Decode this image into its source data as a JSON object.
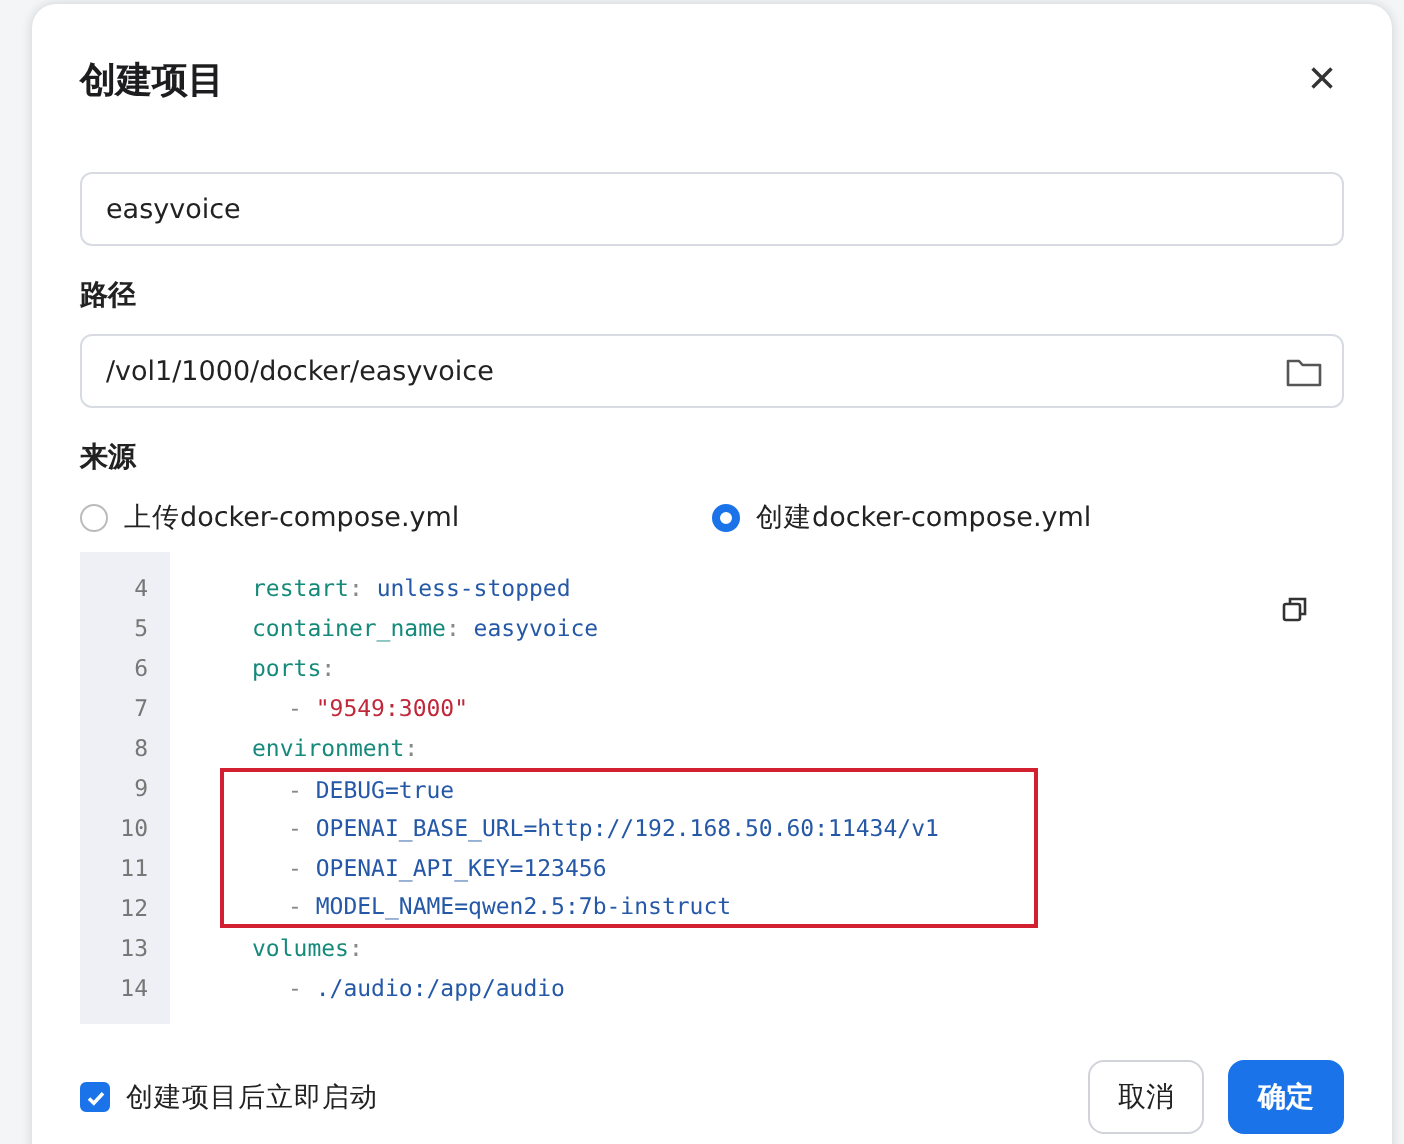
{
  "dialog": {
    "title": "创建项目",
    "close": "×"
  },
  "name_field": {
    "value": "easyvoice"
  },
  "path_field": {
    "label": "路径",
    "value": "/vol1/1000/docker/easyvoice"
  },
  "source": {
    "label": "来源",
    "options": [
      {
        "label": "上传docker-compose.yml",
        "selected": false
      },
      {
        "label": "创建docker-compose.yml",
        "selected": true
      }
    ]
  },
  "editor": {
    "lines": [
      {
        "number": "4",
        "kind": "entry",
        "highlighted": false,
        "parts": [
          {
            "kind": "key",
            "text": "restart"
          },
          {
            "kind": "punct",
            "text": ": "
          },
          {
            "kind": "value",
            "text": "unless-stopped"
          }
        ]
      },
      {
        "number": "5",
        "kind": "entry",
        "highlighted": false,
        "parts": [
          {
            "kind": "key",
            "text": "container_name"
          },
          {
            "kind": "punct",
            "text": ": "
          },
          {
            "kind": "value",
            "text": "easyvoice"
          }
        ]
      },
      {
        "number": "6",
        "kind": "entry",
        "highlighted": false,
        "parts": [
          {
            "kind": "key",
            "text": "ports"
          },
          {
            "kind": "punct",
            "text": ":"
          }
        ]
      },
      {
        "number": "7",
        "kind": "list_item",
        "highlighted": false,
        "parts": [
          {
            "kind": "punct",
            "text": "- "
          },
          {
            "kind": "string",
            "text": "\"9549:3000\""
          }
        ]
      },
      {
        "number": "8",
        "kind": "entry",
        "highlighted": false,
        "parts": [
          {
            "kind": "key",
            "text": "environment"
          },
          {
            "kind": "punct",
            "text": ":"
          }
        ]
      },
      {
        "number": "9",
        "kind": "list_item",
        "highlighted": true,
        "parts": [
          {
            "kind": "punct",
            "text": "- "
          },
          {
            "kind": "value",
            "text": "DEBUG=true"
          }
        ]
      },
      {
        "number": "10",
        "kind": "list_item",
        "highlighted": true,
        "parts": [
          {
            "kind": "punct",
            "text": "- "
          },
          {
            "kind": "value",
            "text": "OPENAI_BASE_URL=http://192.168.50.60:11434/v1"
          }
        ]
      },
      {
        "number": "11",
        "kind": "list_item",
        "highlighted": true,
        "parts": [
          {
            "kind": "punct",
            "text": "- "
          },
          {
            "kind": "value",
            "text": "OPENAI_API_KEY=123456"
          }
        ]
      },
      {
        "number": "12",
        "kind": "list_item",
        "highlighted": true,
        "parts": [
          {
            "kind": "punct",
            "text": "- "
          },
          {
            "kind": "value",
            "text": "MODEL_NAME=qwen2.5:7b-instruct"
          }
        ]
      },
      {
        "number": "13",
        "kind": "entry",
        "highlighted": false,
        "parts": [
          {
            "kind": "key",
            "text": "volumes"
          },
          {
            "kind": "punct",
            "text": ":"
          }
        ]
      },
      {
        "number": "14",
        "kind": "list_item",
        "highlighted": false,
        "parts": [
          {
            "kind": "punct",
            "text": "- "
          },
          {
            "kind": "value",
            "text": "./audio:/app/audio"
          }
        ]
      }
    ]
  },
  "autostart": {
    "label": "创建项目后立即启动",
    "checked": true
  },
  "buttons": [
    {
      "kind": "secondary",
      "label": "取消"
    },
    {
      "kind": "primary",
      "label": "确定"
    }
  ]
}
